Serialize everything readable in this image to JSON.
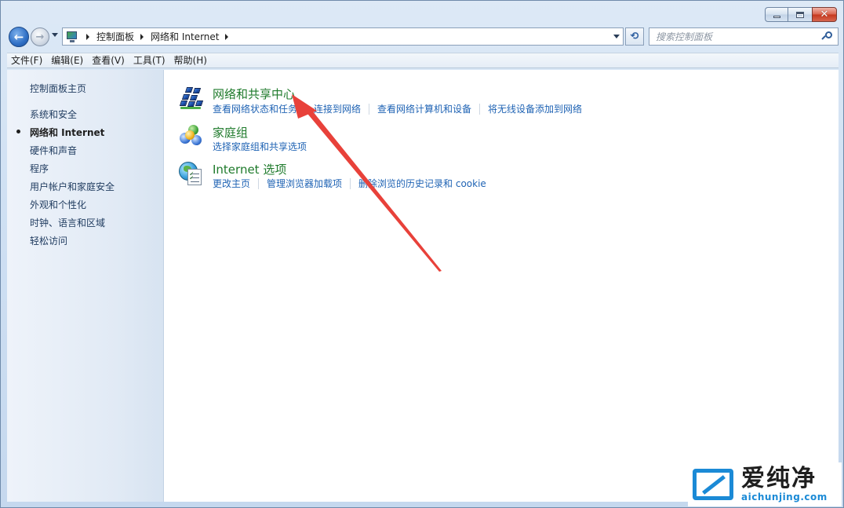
{
  "window": {
    "caption_buttons": {
      "minimize": "minimize",
      "maximize": "maximize",
      "close": "✕"
    }
  },
  "navbar": {
    "back_glyph": "←",
    "forward_glyph": "→",
    "address_crumbs": [
      "控制面板",
      "网络和 Internet"
    ],
    "refresh_glyph": "⟲",
    "search_placeholder": "搜索控制面板"
  },
  "menubar": {
    "items": [
      "文件(F)",
      "编辑(E)",
      "查看(V)",
      "工具(T)",
      "帮助(H)"
    ]
  },
  "sidebar": {
    "home": "控制面板主页",
    "items": [
      "系统和安全",
      "网络和 Internet",
      "硬件和声音",
      "程序",
      "用户帐户和家庭安全",
      "外观和个性化",
      "时钟、语言和区域",
      "轻松访问"
    ],
    "active_index": 1
  },
  "main": {
    "tasks": [
      {
        "title": "网络和共享中心",
        "icon": "network-sharing-icon",
        "links": [
          "查看网络状态和任务",
          "连接到网络",
          "查看网络计算机和设备",
          "将无线设备添加到网络"
        ]
      },
      {
        "title": "家庭组",
        "icon": "homegroup-icon",
        "links": [
          "选择家庭组和共享选项"
        ]
      },
      {
        "title": "Internet 选项",
        "icon": "internet-options-icon",
        "links": [
          "更改主页",
          "管理浏览器加载项",
          "删除浏览的历史记录和 cookie"
        ]
      }
    ]
  },
  "annotation": {
    "color": "#e8413a"
  },
  "watermark": {
    "chinese": "爱纯净",
    "url": "aichunjing.com",
    "color": "#1b8ad6"
  }
}
